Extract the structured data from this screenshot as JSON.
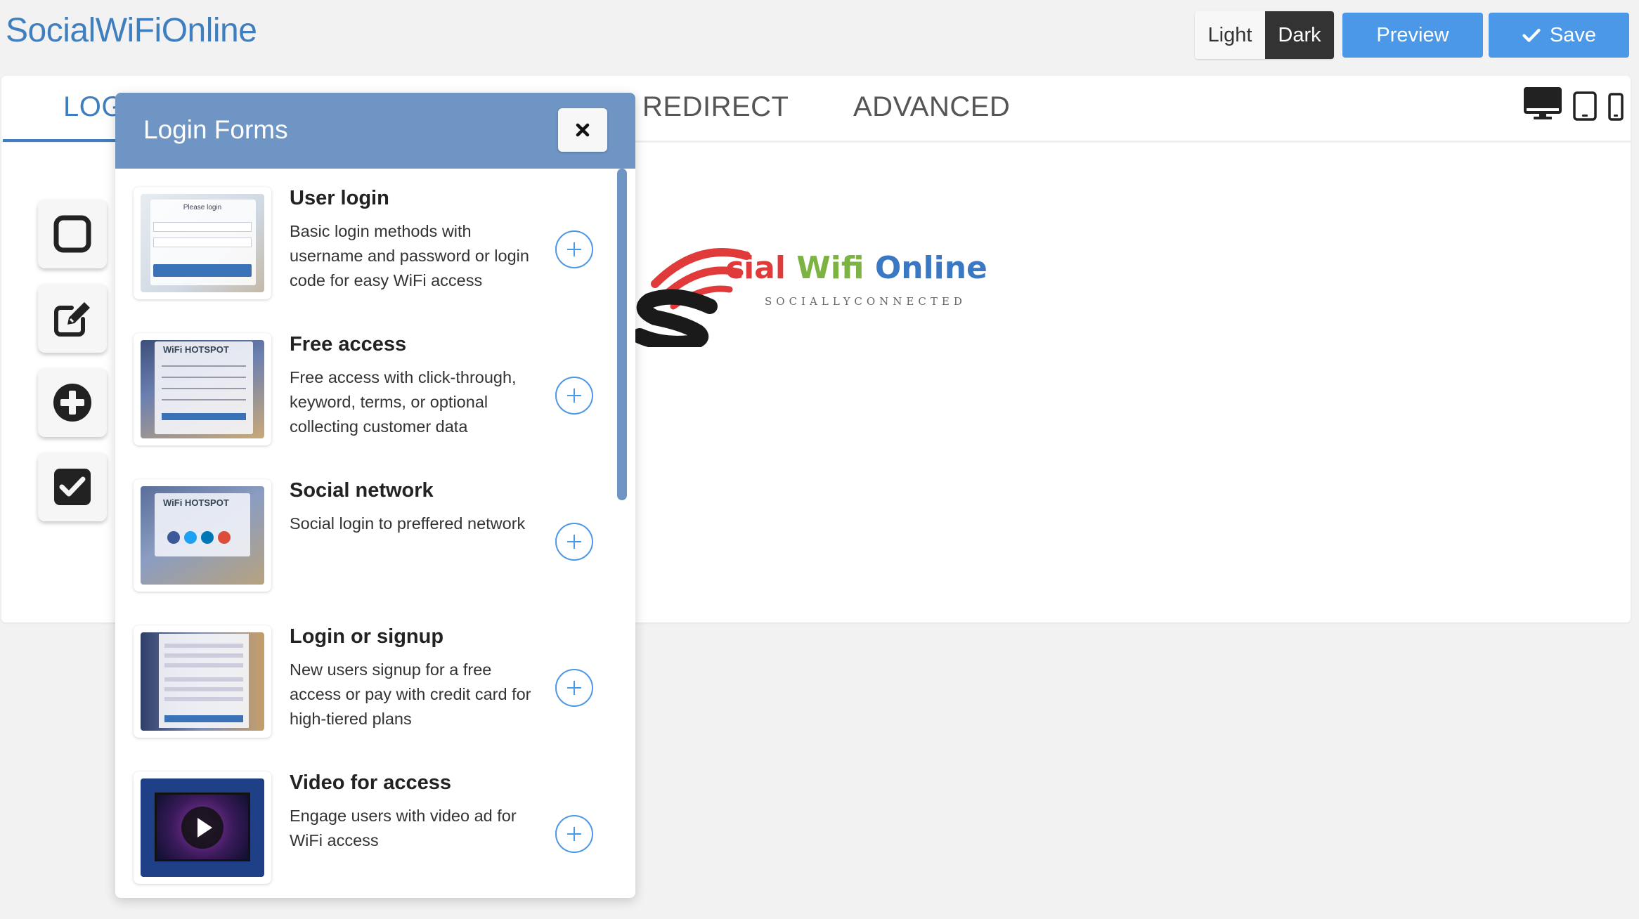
{
  "header": {
    "brand": "SocialWiFiOnline",
    "theme_light": "Light",
    "theme_dark": "Dark",
    "preview_label": "Preview",
    "save_label": "Save"
  },
  "tabs": [
    {
      "label": "LOGIN",
      "active": true
    },
    {
      "label": "REDIRECT",
      "active": false
    },
    {
      "label": "ADVANCED",
      "active": false
    }
  ],
  "tab_visible_partial": "LOG",
  "logo": {
    "text_s": "S",
    "text_cial": "cial",
    "text_wifi": "Wifi",
    "text_online": "Online",
    "tagline": "SOCIALLYCONNECTED"
  },
  "modal": {
    "title": "Login Forms",
    "items": [
      {
        "title": "User login",
        "description": "Basic login methods with username and password or login code for easy WiFi access",
        "thumb_label": "Please login"
      },
      {
        "title": "Free access",
        "description": "Free access with click-through, keyword, terms, or optional collecting customer data",
        "thumb_label": "WiFi HOTSPOT"
      },
      {
        "title": "Social network",
        "description": "Social login to preffered network",
        "thumb_label": "WiFi HOTSPOT"
      },
      {
        "title": "Login or signup",
        "description": "New users signup for a free access or pay with credit card for high-tiered plans",
        "thumb_label": ""
      },
      {
        "title": "Video for access",
        "description": "Engage users with video ad for WiFi access",
        "thumb_label": ""
      }
    ]
  },
  "colors": {
    "accent": "#4a98e7",
    "brand_blue": "#3f7fbf",
    "modal_header": "#6f95c4",
    "dark_toggle": "#333333"
  },
  "icons": {
    "devices": [
      "desktop-icon",
      "tablet-icon",
      "phone-icon"
    ],
    "tools": [
      "square-icon",
      "edit-icon",
      "plus-circle-icon",
      "checkbox-icon"
    ]
  }
}
